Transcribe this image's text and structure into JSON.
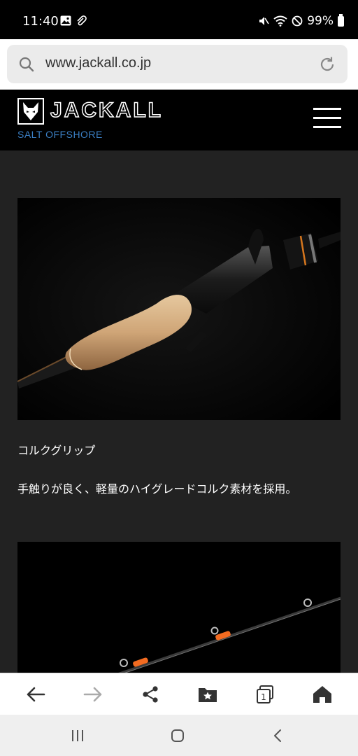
{
  "status_bar": {
    "time": "11:40",
    "battery": "99%"
  },
  "browser": {
    "url": "www.jackall.co.jp"
  },
  "site": {
    "brand": "JACKALL",
    "section": "SALT OFFSHORE"
  },
  "content": {
    "caption_title": "コルクグリップ",
    "caption_body": "手触りが良く、軽量のハイグレードコルク素材を採用。"
  },
  "toolbar": {
    "tab_count": "1"
  },
  "icons": {
    "search": "search-icon",
    "reload": "reload-icon",
    "menu": "hamburger-menu-icon",
    "back": "arrow-left-icon",
    "forward": "arrow-right-icon",
    "share": "share-icon",
    "bookmarks": "bookmark-folder-icon",
    "tabs": "tabs-icon",
    "home": "home-icon"
  },
  "colors": {
    "section_accent": "#3b7fc4",
    "content_background": "#222222",
    "lure_accent": "#f26b21"
  }
}
